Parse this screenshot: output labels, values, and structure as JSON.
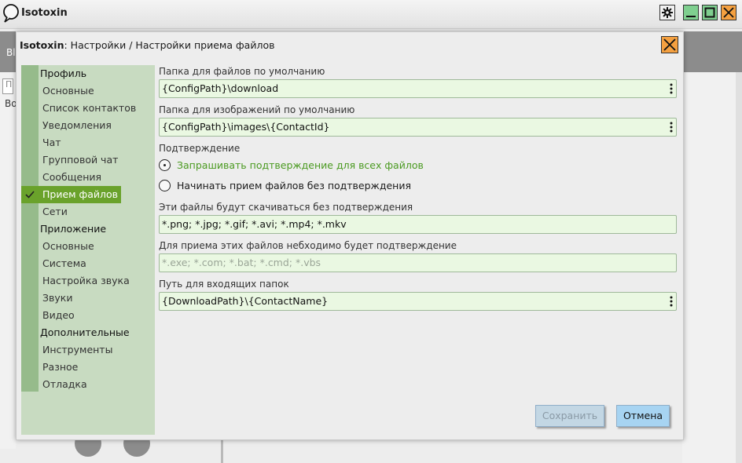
{
  "app": {
    "title": "Isotoxin"
  },
  "background": {
    "input_placeholder": "П",
    "text": "Во",
    "band_text": "Bl"
  },
  "dialog": {
    "title_app": "Isotoxin",
    "title_rest": ": Настройки / Настройки приема файлов"
  },
  "sidebar": {
    "items": [
      {
        "label": "Профиль",
        "kind": "section"
      },
      {
        "label": "Основные",
        "kind": "sub"
      },
      {
        "label": "Список контактов",
        "kind": "sub"
      },
      {
        "label": "Уведомления",
        "kind": "sub"
      },
      {
        "label": "Чат",
        "kind": "sub"
      },
      {
        "label": "Групповой чат",
        "kind": "sub"
      },
      {
        "label": "Сообщения",
        "kind": "sub"
      },
      {
        "label": "Прием файлов",
        "kind": "sub",
        "active": true
      },
      {
        "label": "Сети",
        "kind": "sub"
      },
      {
        "label": "Приложение",
        "kind": "section"
      },
      {
        "label": "Основные",
        "kind": "sub"
      },
      {
        "label": "Система",
        "kind": "sub"
      },
      {
        "label": "Настройка звука",
        "kind": "sub"
      },
      {
        "label": "Звуки",
        "kind": "sub"
      },
      {
        "label": "Видео",
        "kind": "sub"
      },
      {
        "label": "Дополнительные",
        "kind": "section"
      },
      {
        "label": "Инструменты",
        "kind": "sub"
      },
      {
        "label": "Разное",
        "kind": "sub"
      },
      {
        "label": "Отладка",
        "kind": "sub"
      }
    ]
  },
  "form": {
    "download_folder_label": "Папка для файлов по умолчанию",
    "download_folder_value": "{ConfigPath}\\download",
    "images_folder_label": "Папка для изображений по умолчанию",
    "images_folder_value": "{ConfigPath}\\images\\{ContactId}",
    "confirm_label": "Подтверждение",
    "radio_confirm_all": "Запрашивать подтверждение для всех файлов",
    "radio_no_confirm": "Начинать прием файлов без подтверждения",
    "auto_files_label": "Эти файлы будут скачиваться без подтверждения",
    "auto_files_value": "*.png; *.jpg; *.gif; *.avi; *.mp4; *.mkv",
    "confirm_files_label": "Для приема этих файлов небходимо будет подтверждение",
    "confirm_files_placeholder": "*.exe; *.com; *.bat; *.cmd; *.vbs",
    "incoming_path_label": "Путь для входящих папок",
    "incoming_path_value": "{DownloadPath}\\{ContactName}"
  },
  "buttons": {
    "save": "Сохранить",
    "cancel": "Отмена"
  },
  "colors": {
    "accent_green": "#6aa22b",
    "sidebar_bg": "#c8dbc1",
    "field_bg": "#eaf8e2",
    "close_orange": "#f4a040",
    "cancel_blue": "#a7d4f2"
  },
  "icons": {
    "logo": "isotoxin-logo-icon",
    "settings": "gear-icon",
    "minimize": "minimize-icon",
    "maximize": "maximize-icon",
    "close": "close-icon",
    "check": "check-icon",
    "menu": "kebab-menu-icon"
  }
}
